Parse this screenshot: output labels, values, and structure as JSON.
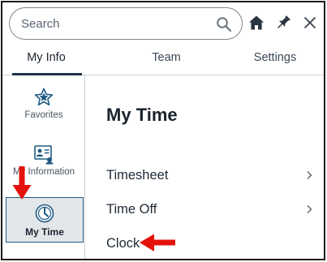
{
  "search": {
    "placeholder": "Search"
  },
  "tabs": [
    {
      "label": "My Info",
      "active": true
    },
    {
      "label": "Team",
      "active": false
    },
    {
      "label": "Settings",
      "active": false
    }
  ],
  "sidebar": {
    "items": [
      {
        "label": "Favorites",
        "icon": "star-icon",
        "active": false
      },
      {
        "label": "My Information",
        "icon": "id-card-icon",
        "active": false
      },
      {
        "label": "My Time",
        "icon": "clock-icon",
        "active": true
      }
    ]
  },
  "main": {
    "title": "My Time",
    "items": [
      {
        "label": "Timesheet",
        "has_chevron": true
      },
      {
        "label": "Time Off",
        "has_chevron": true
      },
      {
        "label": "Clock",
        "has_chevron": false
      }
    ]
  },
  "colors": {
    "accent": "#1e5a82",
    "annotation_red": "#e3120b",
    "active_bg": "#e3e6e9"
  }
}
